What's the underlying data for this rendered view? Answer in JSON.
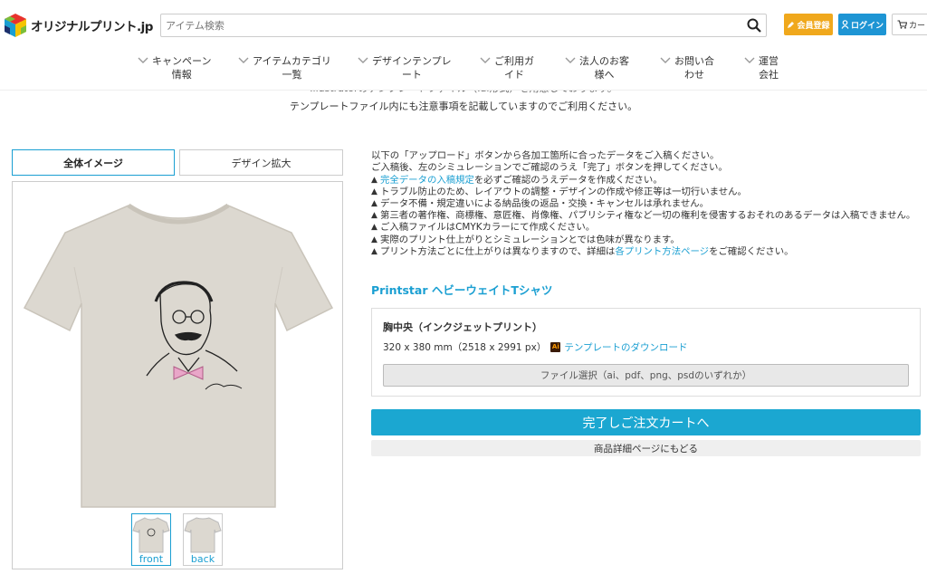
{
  "header": {
    "logo_text": "オリジナルプリント.jp",
    "search_placeholder": "アイテム検索",
    "member_label": "会員登録",
    "login_label": "ログイン",
    "cart_label": "カート"
  },
  "nav": [
    {
      "line1": "キャンペーン",
      "line2": "情報"
    },
    {
      "line1": "アイテムカテゴリ",
      "line2": "一覧"
    },
    {
      "line1": "デザインテンプレ",
      "line2": "ート"
    },
    {
      "line1": "ご利用ガ",
      "line2": "イド"
    },
    {
      "line1": "法人のお客",
      "line2": "様へ"
    },
    {
      "line1": "お問い合",
      "line2": "わせ"
    },
    {
      "line1": "運営",
      "line2": "会社"
    }
  ],
  "ghost": {
    "line1": "Illustratorのテンプレートファイル（.ai形式）を用意しております。",
    "line2": "テンプレートファイル内にも注意事項を記載していますのでご利用ください。"
  },
  "tabs": {
    "all": "全体イメージ",
    "zoom": "デザイン拡大"
  },
  "thumbs": {
    "front": "front",
    "back": "back"
  },
  "intro": {
    "line1": "以下の「アップロード」ボタンから各加工箇所に合ったデータをご入稿ください。",
    "line2": "ご入稿後、左のシミュレーションでご確認のうえ「完了」ボタンを押してください。",
    "warn1_link": "完全データの入稿規定",
    "warn1_rest": "を必ずご確認のうえデータを作成ください。",
    "warn2": "トラブル防止のため、レイアウトの調整・デザインの作成や修正等は一切行いません。",
    "warn3": "データ不備・規定違いによる納品後の返品・交換・キャンセルは承れません。",
    "warn4": "第三者の著作権、商標権、意匠権、肖像権、パブリシティ権など一切の権利を侵害するおそれのあるデータは入稿できません。",
    "warn5": "ご入稿ファイルはCMYKカラーにて作成ください。",
    "warn6": "実際のプリント仕上がりとシミュレーションとでは色味が異なります。",
    "warn7_pre": "プリント方法ごとに仕上がりは異なりますので、詳細は",
    "warn7_link": "各プリント方法ページ",
    "warn7_post": "をご確認ください。"
  },
  "product": {
    "title": "Printstar ヘビーウェイトTシャツ",
    "place": "胸中央（インクジェットプリント）",
    "size": "320 x 380 mm（2518 x 2991 px）",
    "ai_icon": "Ai",
    "template_link": "テンプレートのダウンロード",
    "file_button": "ファイル選択（ai、pdf、png、psdのいずれか）"
  },
  "actions": {
    "complete": "完了しご注文カートへ",
    "back": "商品詳細ページにもどる"
  },
  "colors": {
    "accent": "#1ba7d1",
    "member": "#f0a81c",
    "login": "#1e95d4",
    "shirt": "#dcd8d0"
  }
}
